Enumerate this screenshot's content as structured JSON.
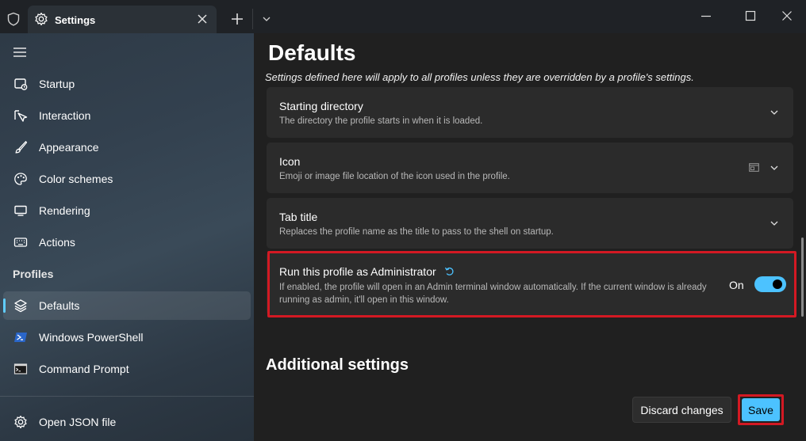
{
  "titlebar": {
    "tab_title": "Settings",
    "icons": [
      "shield-icon",
      "gear-icon",
      "close-icon",
      "plus-icon",
      "chevron-down-icon",
      "minimize-icon",
      "maximize-icon",
      "close-window-icon"
    ]
  },
  "sidebar": {
    "items": [
      {
        "label": "Startup",
        "icon": "startup-icon"
      },
      {
        "label": "Interaction",
        "icon": "interaction-icon"
      },
      {
        "label": "Appearance",
        "icon": "paintbrush-icon"
      },
      {
        "label": "Color schemes",
        "icon": "palette-icon"
      },
      {
        "label": "Rendering",
        "icon": "monitor-icon"
      },
      {
        "label": "Actions",
        "icon": "keyboard-icon"
      }
    ],
    "profiles_header": "Profiles",
    "profiles": [
      {
        "label": "Defaults",
        "icon": "layers-icon",
        "selected": true
      },
      {
        "label": "Windows PowerShell",
        "icon": "powershell-icon"
      },
      {
        "label": "Command Prompt",
        "icon": "cmd-icon"
      }
    ],
    "footer": {
      "label": "Open JSON file",
      "icon": "gear-icon"
    }
  },
  "main": {
    "title": "Defaults",
    "subtitle": "Settings defined here will apply to all profiles unless they are overridden by a profile's settings.",
    "cards": [
      {
        "title": "Starting directory",
        "description": "The directory the profile starts in when it is loaded."
      },
      {
        "title": "Icon",
        "description": "Emoji or image file location of the icon used in the profile."
      },
      {
        "title": "Tab title",
        "description": "Replaces the profile name as the title to pass to the shell on startup."
      }
    ],
    "admin": {
      "title": "Run this profile as Administrator",
      "description": "If enabled, the profile will open in an Admin terminal window automatically. If the current window is already running as admin, it'll open in this window.",
      "toggle_label": "On",
      "toggle_on": true
    },
    "additional_title": "Additional settings",
    "discard_label": "Discard changes",
    "save_label": "Save"
  },
  "colors": {
    "accent": "#4cc2ff",
    "highlight": "#d31923"
  }
}
